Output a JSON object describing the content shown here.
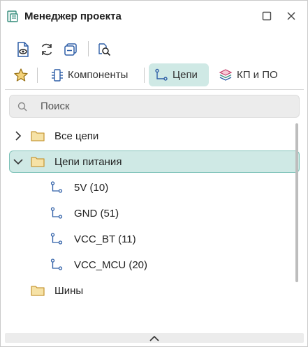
{
  "window": {
    "title": "Менеджер проекта",
    "icon": "project-manager-icon"
  },
  "toolbar": {
    "icons": [
      "document-view-icon",
      "refresh-icon",
      "collapse-icon",
      "find-icon"
    ]
  },
  "tabs": {
    "favorites_icon": "star-icon",
    "items": [
      {
        "label": "Компоненты",
        "icon": "component-icon",
        "active": false
      },
      {
        "label": "Цепи",
        "icon": "net-icon",
        "active": true
      },
      {
        "label": "КП и ПО",
        "icon": "layers-icon",
        "active": false
      }
    ]
  },
  "search": {
    "placeholder": "Поиск",
    "value": ""
  },
  "tree": {
    "items": [
      {
        "label": "Все цепи",
        "type": "folder",
        "expanded": false,
        "selected": false
      },
      {
        "label": "Цепи питания",
        "type": "folder",
        "expanded": true,
        "selected": true
      },
      {
        "label": "5V (10)",
        "type": "net"
      },
      {
        "label": "GND (51)",
        "type": "net"
      },
      {
        "label": "VCC_BT (11)",
        "type": "net"
      },
      {
        "label": "VCC_MCU (20)",
        "type": "net"
      },
      {
        "label": "Шины",
        "type": "folder",
        "expanded": false,
        "selected": false
      }
    ]
  },
  "colors": {
    "accent": "#cfe9e5",
    "accent_border": "#7ec2b8",
    "icon_blue": "#2f5fa7",
    "folder_fill": "#f6e2a6",
    "folder_stroke": "#c89a3a",
    "star": "#e0b43a"
  }
}
